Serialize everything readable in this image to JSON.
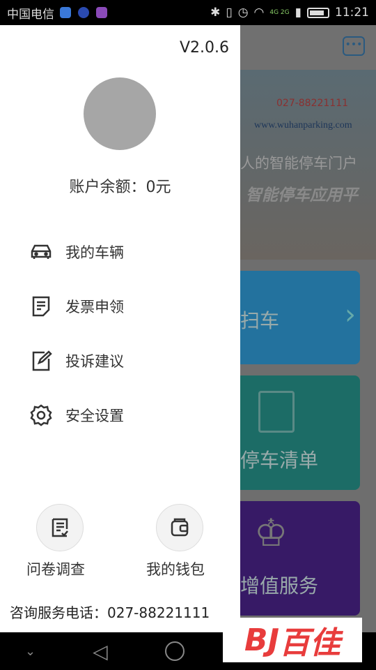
{
  "status_bar": {
    "carrier": "中国电信",
    "time": "11:21",
    "network": "4G 2G"
  },
  "background": {
    "banner_phone": "027-88221111",
    "banner_url": "www.wuhanparking.com",
    "banner_slogan1": "人的智能停车门户",
    "banner_slogan2": "智能停车应用平",
    "tiles": [
      "扫车",
      "停车清单",
      "增值服务"
    ]
  },
  "drawer": {
    "version": "V2.0.6",
    "balance": "账户余额：0元",
    "menu": [
      {
        "label": "我的车辆",
        "icon": "car-icon"
      },
      {
        "label": "发票申领",
        "icon": "invoice-icon"
      },
      {
        "label": "投诉建议",
        "icon": "edit-icon"
      },
      {
        "label": "安全设置",
        "icon": "gear-icon"
      }
    ],
    "shortcuts": [
      {
        "label": "问卷调查",
        "icon": "survey-icon"
      },
      {
        "label": "我的钱包",
        "icon": "wallet-icon"
      }
    ],
    "hotline": "咨询服务电话：027-88221111"
  },
  "watermark": "BJ百佳",
  "colors": {
    "tile_blue": "#23729e",
    "tile_teal": "#1c6c66",
    "tile_purple": "#371a66",
    "avatar": "#a6a6a6"
  }
}
